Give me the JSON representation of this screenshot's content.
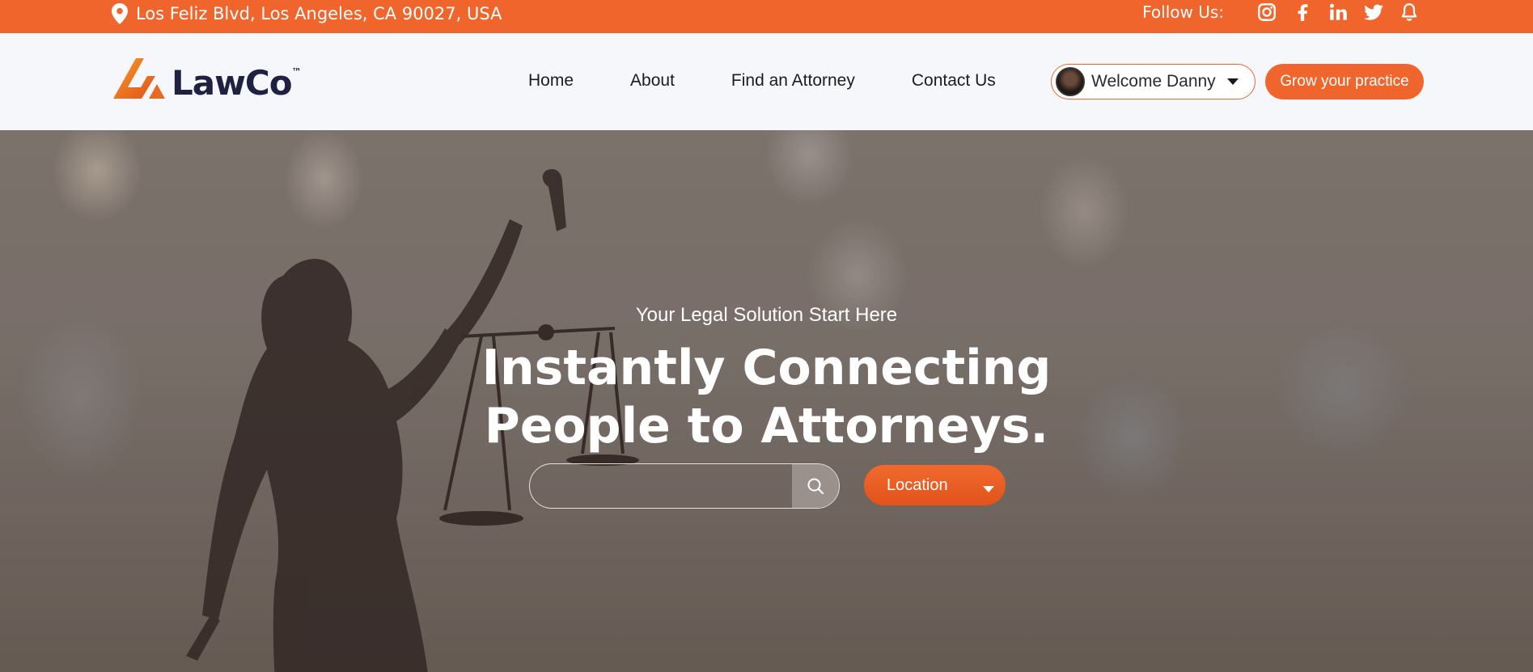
{
  "topbar": {
    "address": "Los Feliz Blvd, Los Angeles, CA 90027, USA",
    "follow_label": "Follow Us:",
    "social_icons": [
      "instagram-icon",
      "facebook-icon",
      "linkedin-icon",
      "twitter-icon",
      "bell-icon"
    ],
    "background": "#f0652c"
  },
  "brand": {
    "name": "LawCo",
    "tm": "™",
    "accent": "#f0652c",
    "dark": "#1f2140"
  },
  "nav": {
    "items": [
      {
        "label": "Home"
      },
      {
        "label": "About"
      },
      {
        "label": "Find an Attorney"
      },
      {
        "label": "Contact Us"
      }
    ],
    "welcome": "Welcome Danny",
    "cta": "Grow your practice"
  },
  "hero": {
    "subtitle": "Your Legal Solution Start Here",
    "title_line1": "Instantly Connecting",
    "title_line2": "People to Attorneys.",
    "search_placeholder": "",
    "location_label": "Location"
  }
}
